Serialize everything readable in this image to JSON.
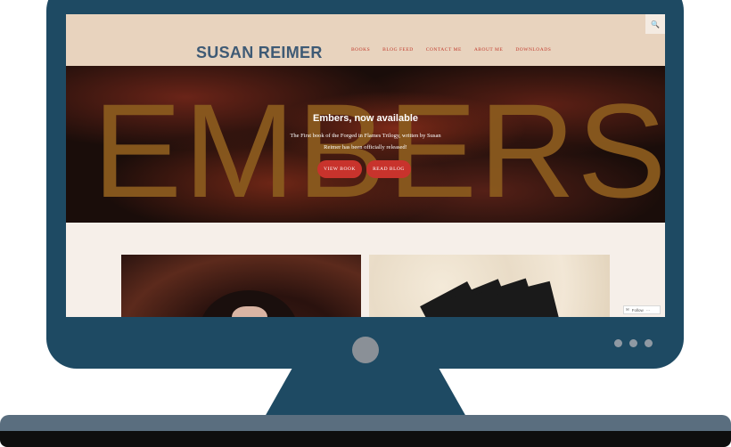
{
  "site": {
    "title": "SUSAN REIMER",
    "nav": [
      "BOOKS",
      "BLOG FEED",
      "CONTACT ME",
      "ABOUT ME",
      "DOWNLOADS"
    ]
  },
  "hero": {
    "big_word": "EMBERS",
    "title": "Embers, now available",
    "text": "The First book of the Forged in Flames Trilogy, written by Susan Reimer has been officially released!",
    "buttons": [
      "VIEW BOOK",
      "READ BLOG"
    ]
  },
  "widget": {
    "follow_label": "Follow",
    "more": "···"
  },
  "colors": {
    "frame": "#1e4a63",
    "header": "#e8d3be",
    "accent": "#c8332c",
    "title": "#3e5a75",
    "embers": "#8a5a1e"
  }
}
